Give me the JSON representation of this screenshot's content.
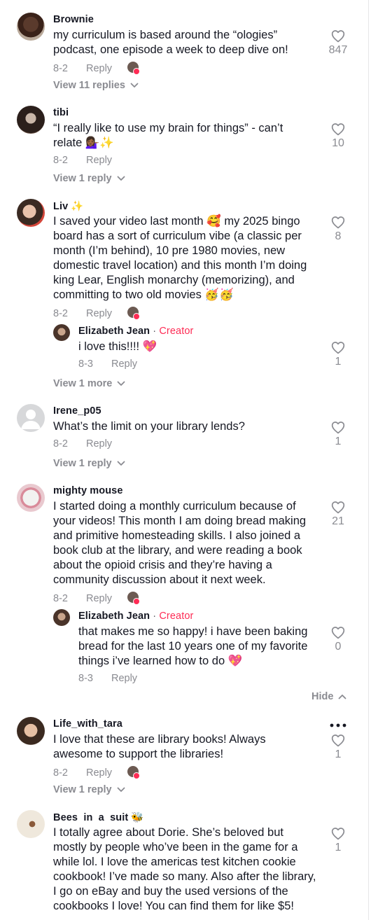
{
  "colors": {
    "text": "#161823",
    "muted": "#8a8b91",
    "creator": "#fe2c55"
  },
  "comments": [
    {
      "username": "Brownie",
      "text": "my curriculum is based around the “ologies” podcast, one episode a week to deep dive on!",
      "date": "8-2",
      "reply_label": "Reply",
      "likes": "847",
      "view_replies": "View 11 replies"
    },
    {
      "username": "tibi",
      "text": "“I really like to use my brain for things” - can’t relate 💁🏾‍♀️✨",
      "date": "8-2",
      "reply_label": "Reply",
      "likes": "10",
      "view_replies": "View 1 reply"
    },
    {
      "username": "Liv ✨",
      "text": "I saved your video last month 🥰 my 2025 bingo board has a sort of curriculum vibe (a classic per month (I’m behind), 10 pre 1980 movies, new domestic travel location) and this month I’m doing king Lear, English monarchy (memorizing), and committing to two old movies 🥳🥳",
      "date": "8-2",
      "reply_label": "Reply",
      "likes": "8",
      "reply": {
        "username": "Elizabeth Jean",
        "separator": "·",
        "badge": "Creator",
        "text": "i love this!!!! 💖",
        "date": "8-3",
        "reply_label": "Reply",
        "likes": "1"
      },
      "view_replies": "View 1 more"
    },
    {
      "username": "Irene_p05",
      "text": "What’s the limit on your library lends?",
      "date": "8-2",
      "reply_label": "Reply",
      "likes": "1",
      "view_replies": "View 1 reply"
    },
    {
      "username": "mighty mouse",
      "text": "I started doing a monthly curriculum because of your videos! This month I am doing bread making and primitive homesteading skills. I also joined a book club at the library, and were reading a book about the opioid crisis and they’re having a community discussion about it next week.",
      "date": "8-2",
      "reply_label": "Reply",
      "likes": "21",
      "reply": {
        "username": "Elizabeth Jean",
        "separator": "·",
        "badge": "Creator",
        "text": "that makes me so happy! i have been baking bread for the last 10 years one of my favorite things i’ve learned how to do 💖",
        "date": "8-3",
        "reply_label": "Reply",
        "likes": "0"
      },
      "hide_label": "Hide"
    },
    {
      "username": "Life_with_tara",
      "text": "I love that these are library books! Always awesome to support the libraries!",
      "date": "8-2",
      "reply_label": "Reply",
      "likes": "1",
      "view_replies": "View 1 reply"
    },
    {
      "username": "Bees  in  a  suit 🐝",
      "text": "I totally agree about Dorie. She’s beloved but mostly by people who’ve been in the game for a while lol. I love the americas test kitchen cookie cookbook! I’ve made so many. Also after the library, I go on eBay and buy the used versions of the cookbooks I love! You can find them for like $5!",
      "likes": "1"
    }
  ]
}
